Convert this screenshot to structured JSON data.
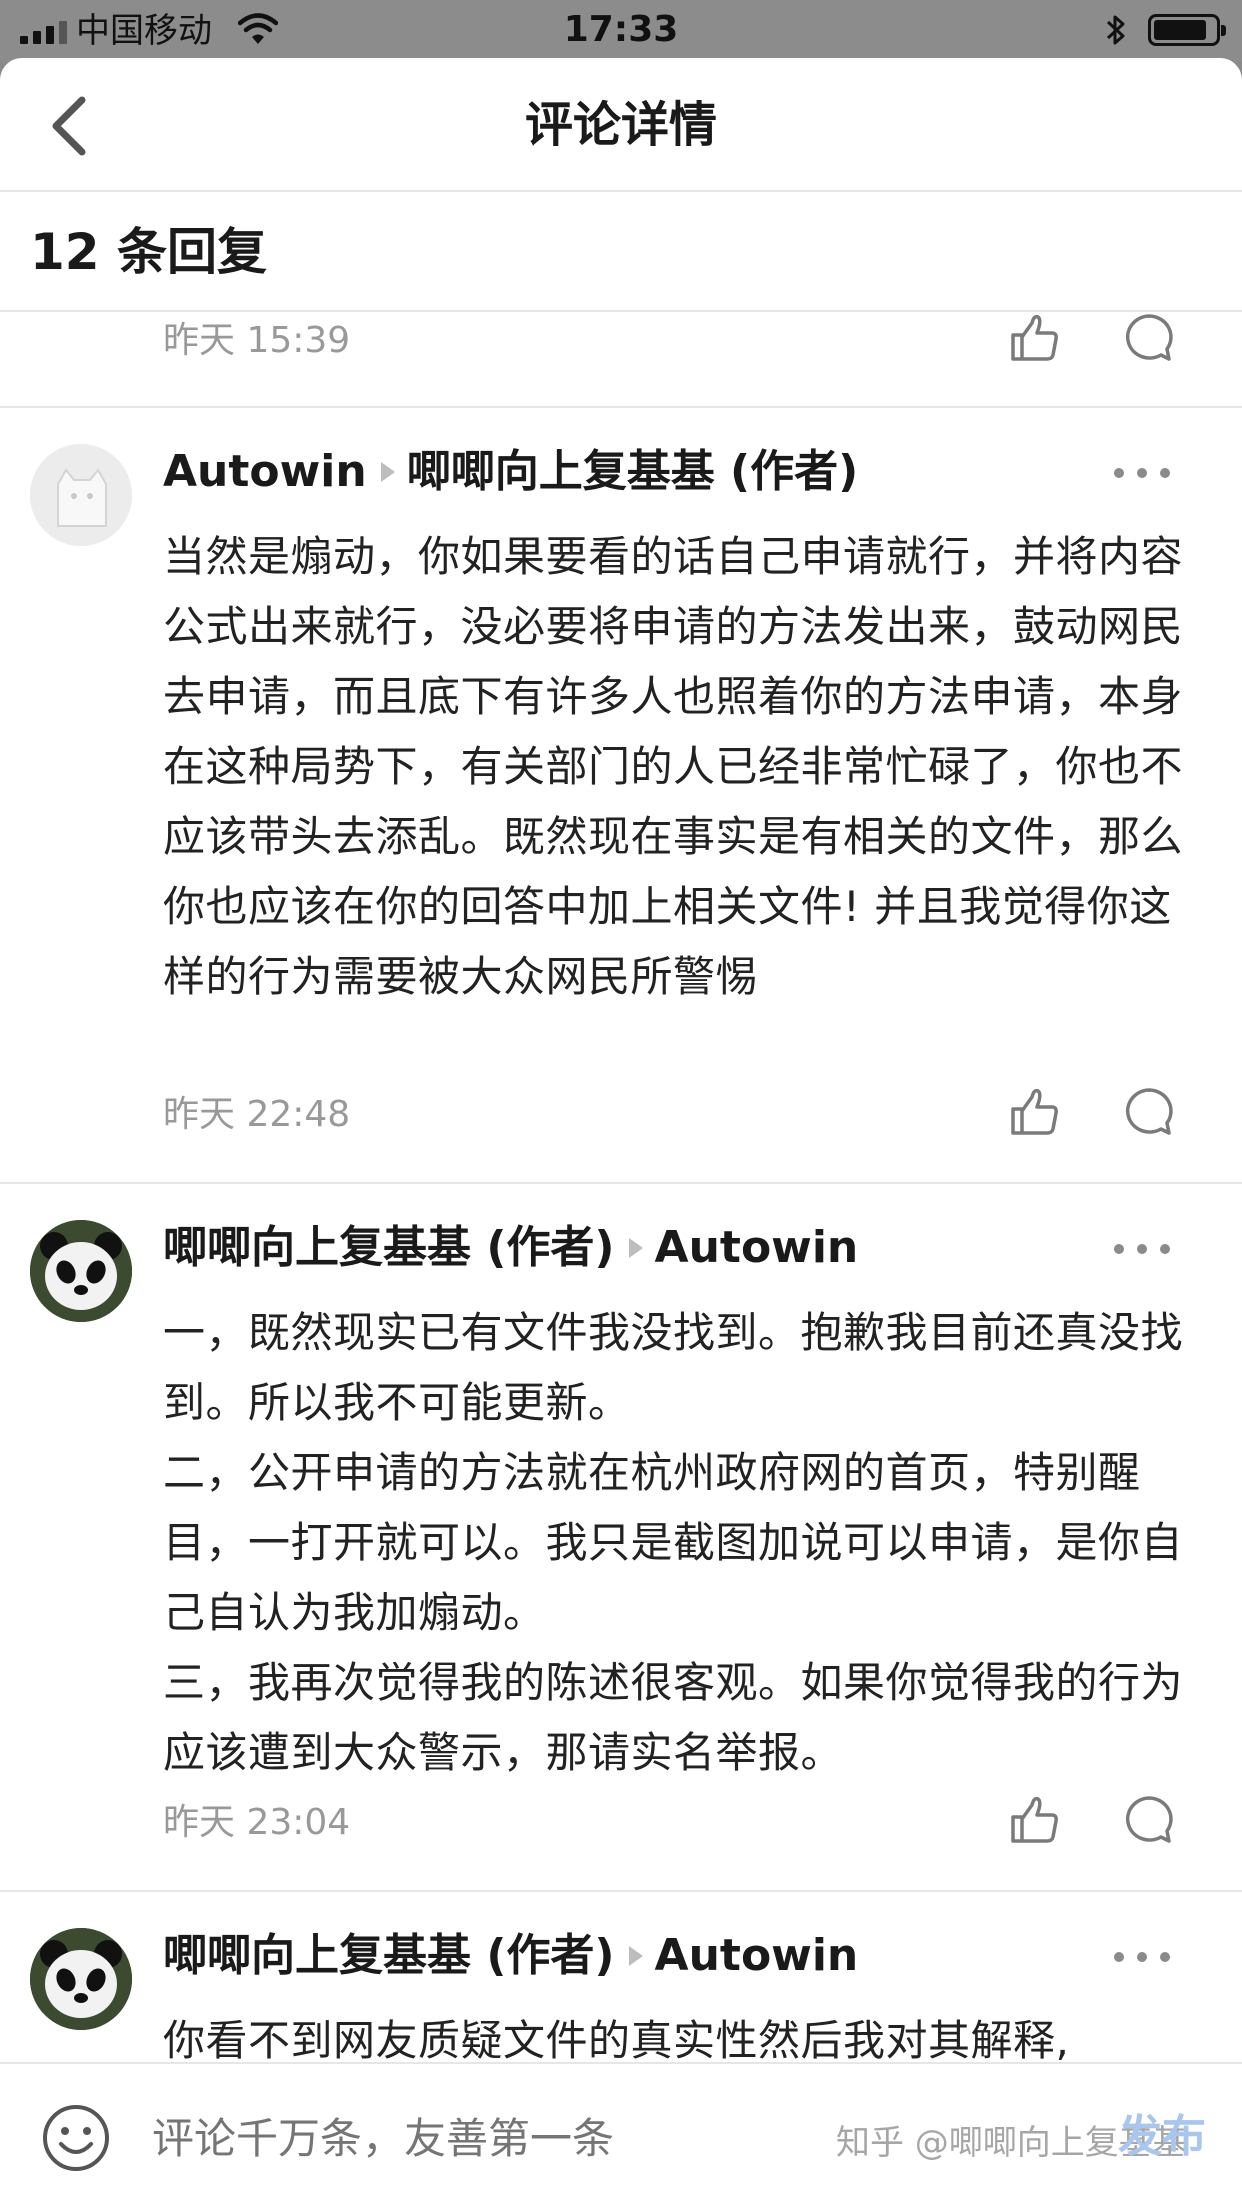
{
  "status_bar": {
    "carrier": "中国移动",
    "time": "17:33"
  },
  "nav": {
    "title": "评论详情"
  },
  "header": {
    "reply_count": "12 条回复"
  },
  "prev_comment": {
    "time": "昨天 15:39"
  },
  "comments": [
    {
      "author": "Autowin",
      "reply_to": "唧唧向上复基基 (作者)",
      "avatar_icon": "cat-avatar-icon",
      "paragraphs": [
        "当然是煽动，你如果要看的话自己申请就行，并将内容公式出来就行，没必要将申请的方法发出来，鼓动网民去申请，而且底下有许多人也照着你的方法申请，本身在这种局势下，有关部门的人已经非常忙碌了，你也不应该带头去添乱。既然现在事实是有相关的文件，那么你也应该在你的回答中加上相关文件! 并且我觉得你这样的行为需要被大众网民所警惕"
      ],
      "time": "昨天 22:48"
    },
    {
      "author": "唧唧向上复基基 (作者)",
      "reply_to": "Autowin",
      "avatar_icon": "panda-avatar-icon",
      "paragraphs": [
        "一，既然现实已有文件我没找到。抱歉我目前还真没找到。所以我不可能更新。",
        "二，公开申请的方法就在杭州政府网的首页，特别醒目，一打开就可以。我只是截图加说可以申请，是你自己自认为我加煽动。",
        "三，我再次觉得我的陈述很客观。如果你觉得我的行为应该遭到大众警示，那请实名举报。"
      ],
      "time": "昨天 23:04"
    },
    {
      "author": "唧唧向上复基基 (作者)",
      "reply_to": "Autowin",
      "avatar_icon": "panda-avatar-icon",
      "paragraphs": [
        "你看不到网友质疑文件的真实性然后我对其解释,"
      ]
    }
  ],
  "bottom_bar": {
    "placeholder": "评论千万条，友善第一条",
    "publish": "发布",
    "watermark": "知乎 @唧唧向上复基基"
  },
  "colors": {
    "status_bar_bg": "#8c8c8c",
    "time_gray": "#999999",
    "publish_disabled_blue": "#a9c6ef",
    "divider": "#e6e6e6"
  }
}
